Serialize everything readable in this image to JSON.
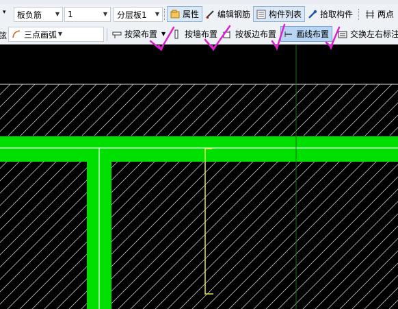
{
  "toolbar1": {
    "left_arrow": "▾",
    "component_type": "板负筋",
    "layer_value": "1",
    "floor_slab": "分层板1",
    "properties_label": "属性",
    "edit_rebar_label": "编辑钢筋",
    "component_list_label": "构件列表",
    "pick_component_label": "拾取构件",
    "two_point_label": "两点"
  },
  "toolbar2": {
    "cut_char": "弦",
    "arc_mode": "三点画弧",
    "beam_layout_label": "按梁布置",
    "wall_layout_label": "按墙布置",
    "slab_edge_layout_label": "按板边布置",
    "line_layout_label": "画线布置",
    "swap_label_label": "交换左右标注"
  },
  "colors": {
    "toolbar_bg": "#eef1f6",
    "canvas_bg": "#000000",
    "beam_green": "#00e000",
    "hatch": "#bfbfbf",
    "rebar_yellow": "#e6e64a",
    "check_mark": "#e020d0",
    "axis_line": "#1f6b1f"
  },
  "icons": [
    "properties-icon",
    "edit-rebar-icon",
    "component-list-icon",
    "pick-component-icon",
    "two-point-icon",
    "arc-icon",
    "beam-layout-icon",
    "wall-layout-icon",
    "slab-edge-layout-icon",
    "line-layout-icon",
    "swap-label-icon"
  ]
}
